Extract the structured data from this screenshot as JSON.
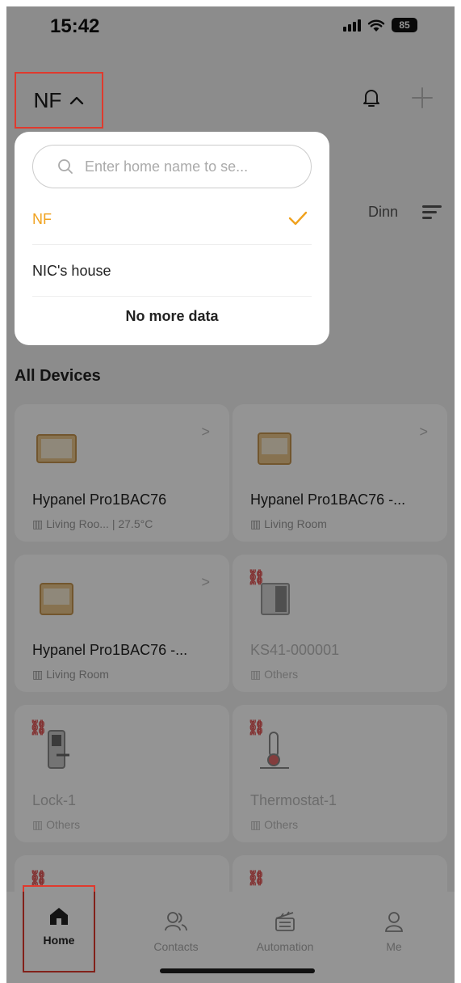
{
  "status": {
    "time": "15:42",
    "battery": "85"
  },
  "header": {
    "home_name": "NF",
    "chevron": "^",
    "bell_icon": "bell-icon",
    "add_icon": "plus-icon"
  },
  "rooms": {
    "tabs": [
      "Dinn"
    ]
  },
  "section_title": "All Devices",
  "devices": [
    {
      "name": "Hypanel Pro1BAC76",
      "room": "Living Roo... | 27.5°C",
      "online": true
    },
    {
      "name": "Hypanel Pro1BAC76 -...",
      "room": "Living Room",
      "online": true
    },
    {
      "name": "Hypanel Pro1BAC76 -...",
      "room": "Living Room",
      "online": true
    },
    {
      "name": "KS41-000001",
      "room": "Others",
      "online": false
    },
    {
      "name": "Lock-1",
      "room": "Others",
      "online": false
    },
    {
      "name": "Thermostat-1",
      "room": "Others",
      "online": false
    }
  ],
  "dropdown": {
    "search_placeholder": "Enter home name to se...",
    "options": [
      "NF",
      "NIC's house"
    ],
    "selected": "NF",
    "footer": "No more data"
  },
  "tabbar": {
    "tabs": [
      {
        "label": "Home",
        "icon": "home-icon"
      },
      {
        "label": "Contacts",
        "icon": "contacts-icon"
      },
      {
        "label": "Automation",
        "icon": "automation-icon"
      },
      {
        "label": "Me",
        "icon": "person-icon"
      }
    ],
    "active": "Home"
  },
  "colors": {
    "accent": "#f0a21e",
    "highlight": "#e03a2e",
    "offline_link": "#e05050"
  }
}
